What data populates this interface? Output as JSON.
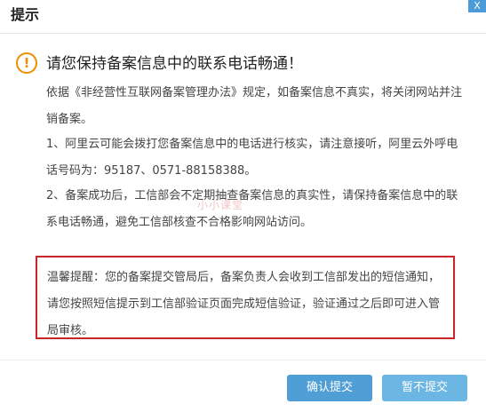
{
  "dialog": {
    "title": "提示",
    "close": "X",
    "heading": "请您保持备案信息中的联系电话畅通！",
    "paragraph1": "依据《非经营性互联网备案管理办法》规定，如备案信息不真实，将关闭网站并注销备案。",
    "paragraph2": "1、阿里云可能会拨打您备案信息中的电话进行核实，请注意接听，阿里云外呼电话号码为：95187、0571-88158388。",
    "paragraph3": "2、备案成功后，工信部会不定期抽查备案信息的真实性，请保持备案信息中的联系电话畅通，避免工信部核查不合格影响网站访问。",
    "watermark": "小小课堂",
    "reminder": "温馨提醒：您的备案提交管局后，备案负责人会收到工信部发出的短信通知，请您按照短信提示到工信部验证页面完成短信验证，验证通过之后即可进入管局审核。",
    "buttons": {
      "confirm": "确认提交",
      "cancel": "暂不提交"
    }
  },
  "colors": {
    "warning": "#f08c00",
    "highlight_border": "#c9262c",
    "button": "#5aa9dd"
  },
  "icons": [
    "close-icon",
    "warning-icon"
  ]
}
